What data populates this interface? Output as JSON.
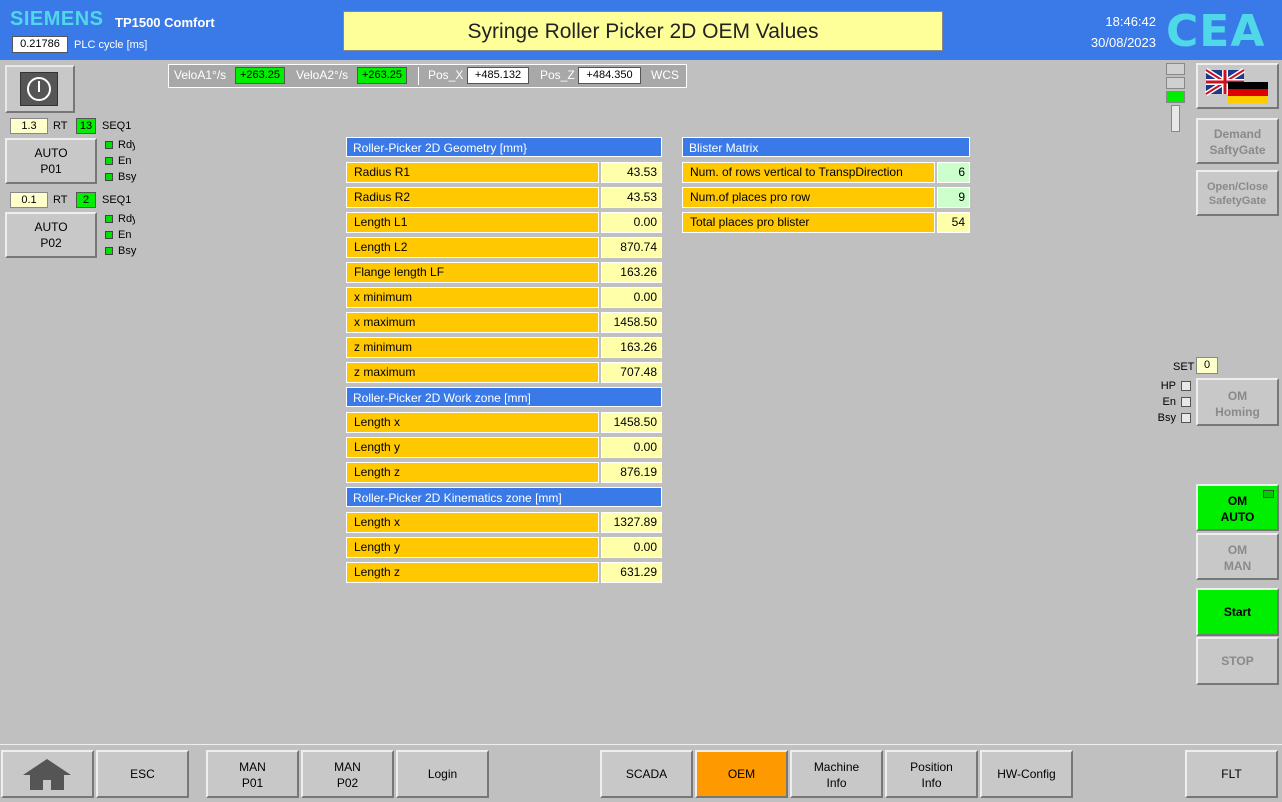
{
  "header": {
    "brand": "SIEMENS",
    "model": "TP1500 Comfort",
    "plc_cycle_value": "0.21786",
    "plc_cycle_label": "PLC cycle [ms]",
    "title": "Syringe Roller Picker 2D OEM Values",
    "time": "18:46:42",
    "date": "30/08/2023",
    "logo": "CEA"
  },
  "velocity": {
    "velo_a1_label": "VeloA1°/s",
    "velo_a1_value": "+263.25",
    "velo_a2_label": "VeloA2°/s",
    "velo_a2_value": "+263.25",
    "pos_x_label": "Pos_X",
    "pos_x_value": "+485.132",
    "pos_z_label": "Pos_Z",
    "pos_z_value": "+484.350",
    "frame": "WCS"
  },
  "left_panel": {
    "power_icon": "power-icon",
    "p01": {
      "rt_value": "1.3",
      "rt_label": "RT",
      "seq_value": "13",
      "seq_label": "SEQ1",
      "button_line1": "AUTO",
      "button_line2": "P01",
      "leds": [
        "Rdy",
        "En",
        "Bsy"
      ]
    },
    "p02": {
      "rt_value": "0.1",
      "rt_label": "RT",
      "seq_value": "2",
      "seq_label": "SEQ1",
      "button_line1": "AUTO",
      "button_line2": "P02",
      "leds": [
        "Rdy",
        "En",
        "Bsy"
      ]
    }
  },
  "geometry": {
    "header": "Roller-Picker 2D Geometry [mm}",
    "rows": [
      {
        "label": "Radius R1",
        "value": "43.53"
      },
      {
        "label": "Radius R2",
        "value": "43.53"
      },
      {
        "label": "Length L1",
        "value": "0.00"
      },
      {
        "label": "Length L2",
        "value": "870.74"
      },
      {
        "label": "Flange length LF",
        "value": "163.26"
      },
      {
        "label": "x minimum",
        "value": "0.00"
      },
      {
        "label": "x maximum",
        "value": "1458.50"
      },
      {
        "label": "z minimum",
        "value": "163.26"
      },
      {
        "label": "z maximum",
        "value": "707.48"
      }
    ]
  },
  "workzone": {
    "header": "Roller-Picker 2D Work zone [mm]",
    "rows": [
      {
        "label": "Length x",
        "value": "1458.50"
      },
      {
        "label": "Length y",
        "value": "0.00"
      },
      {
        "label": "Length z",
        "value": "876.19"
      }
    ]
  },
  "kinematics": {
    "header": "Roller-Picker 2D Kinematics zone [mm]",
    "rows": [
      {
        "label": "Length x",
        "value": "1327.89"
      },
      {
        "label": "Length y",
        "value": "0.00"
      },
      {
        "label": "Length z",
        "value": "631.29"
      }
    ]
  },
  "blister": {
    "header": "Blister Matrix",
    "rows": [
      {
        "label": "Num. of rows vertical to TranspDirection",
        "value": "6"
      },
      {
        "label": "Num.of places pro row",
        "value": "9"
      },
      {
        "label": "Total places pro blister",
        "value": "54"
      }
    ]
  },
  "right_panel": {
    "flag_icon": "uk-germany-flag-icon",
    "demand_line1": "Demand",
    "demand_line2": "SaftyGate",
    "openclose_line1": "Open/Close",
    "openclose_line2": "SafetyGate",
    "set_label": "SET",
    "set_value": "0",
    "checks": [
      "HP",
      "En",
      "Bsy"
    ],
    "om_homing_line1": "OM",
    "om_homing_line2": "Homing",
    "om_auto_line1": "OM",
    "om_auto_line2": "AUTO",
    "om_man_line1": "OM",
    "om_man_line2": "MAN",
    "start": "Start",
    "stop": "STOP"
  },
  "bottom": {
    "home_icon": "home-icon",
    "esc": "ESC",
    "man_p01_line1": "MAN",
    "man_p01_line2": "P01",
    "man_p02_line1": "MAN",
    "man_p02_line2": "P02",
    "login": "Login",
    "scada": "SCADA",
    "oem": "OEM",
    "machine_info_line1": "Machine",
    "machine_info_line2": "Info",
    "position_info_line1": "Position",
    "position_info_line2": "Info",
    "hw_config": "HW-Config",
    "flt": "FLT"
  },
  "colors": {
    "header_blue": "#3a7ae8",
    "label_orange": "#ffc800",
    "value_yellow": "#ffffaa",
    "status_green": "#00ee00",
    "active_orange": "#ff9900"
  }
}
